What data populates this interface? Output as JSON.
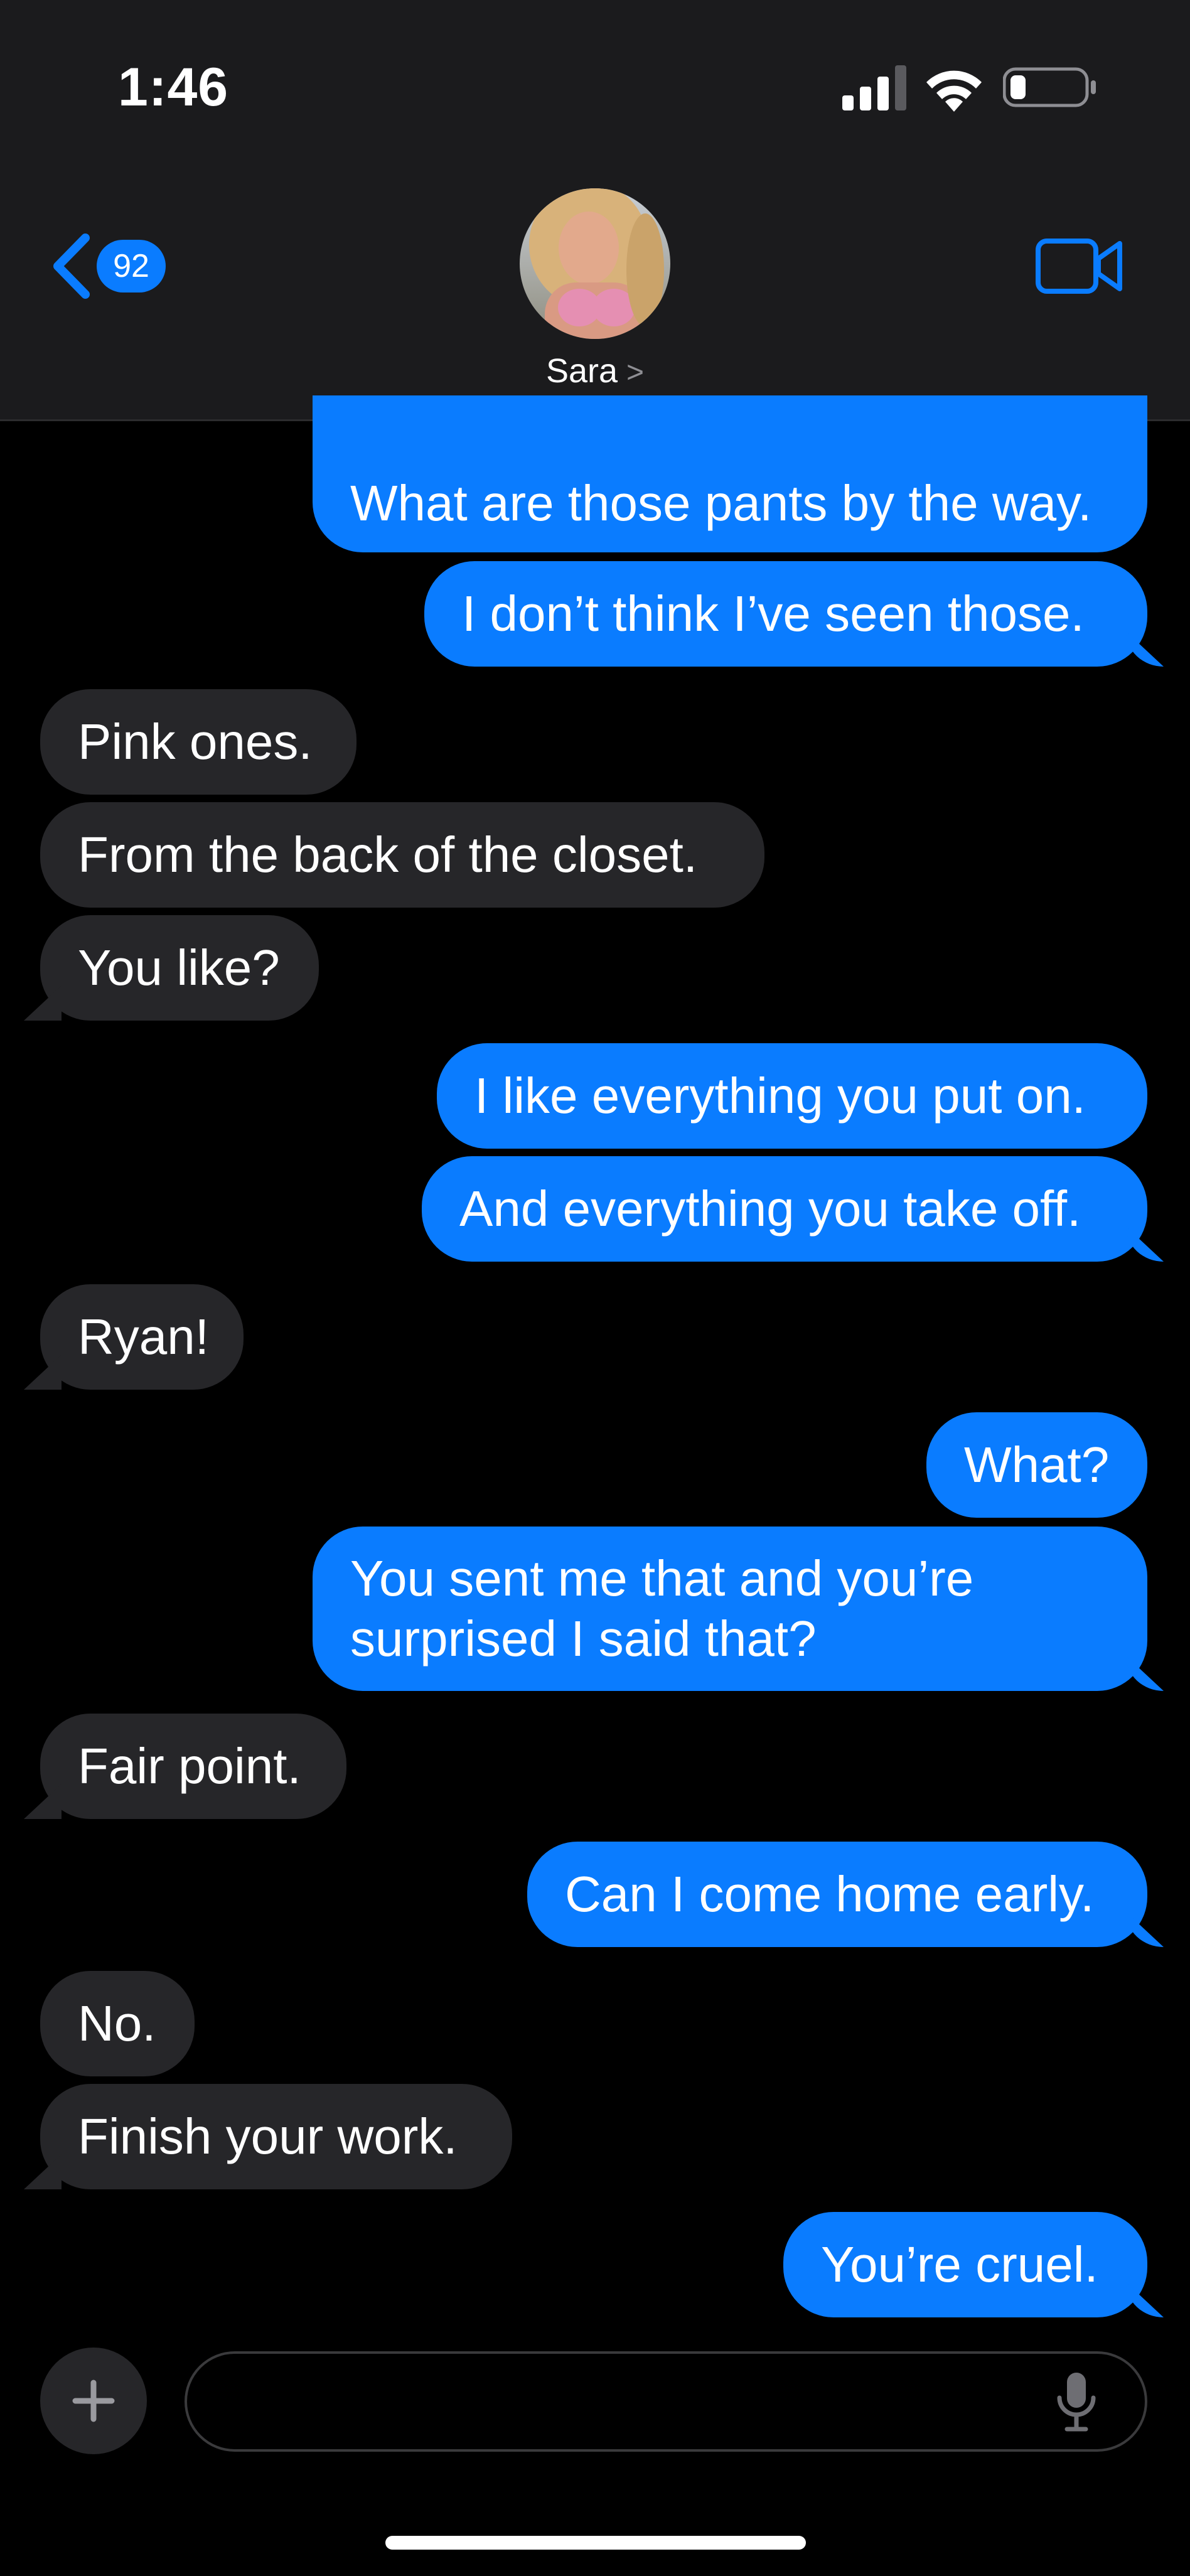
{
  "status_bar": {
    "time": "1:46"
  },
  "header": {
    "back_badge": "92",
    "contact_name": "Sara",
    "contact_chevron": ">"
  },
  "messages": [
    {
      "from": "me",
      "text": "What are those pants by the way."
    },
    {
      "from": "me",
      "text": "I don’t think I’ve seen those."
    },
    {
      "from": "them",
      "text": "Pink ones."
    },
    {
      "from": "them",
      "text": "From the back of the closet."
    },
    {
      "from": "them",
      "text": "You like?"
    },
    {
      "from": "me",
      "text": "I like everything you put on."
    },
    {
      "from": "me",
      "text": "And everything you take off."
    },
    {
      "from": "them",
      "text": "Ryan!"
    },
    {
      "from": "me",
      "text": "What?"
    },
    {
      "from": "me",
      "text": "You sent me that and you’re surprised I said that?"
    },
    {
      "from": "them",
      "text": "Fair point."
    },
    {
      "from": "me",
      "text": "Can I come home early."
    },
    {
      "from": "them",
      "text": "No."
    },
    {
      "from": "them",
      "text": "Finish your work."
    },
    {
      "from": "me",
      "text": "You’re cruel."
    }
  ],
  "composer": {
    "value": "",
    "placeholder": ""
  },
  "colors": {
    "outgoing": "#0a7cff",
    "incoming": "#262629",
    "header_bg": "#1b1b1d",
    "accent": "#0a7cff"
  },
  "icons": [
    "signal-icon",
    "wifi-icon",
    "battery-icon",
    "back-chevron-icon",
    "video-camera-icon",
    "plus-icon",
    "microphone-icon"
  ]
}
